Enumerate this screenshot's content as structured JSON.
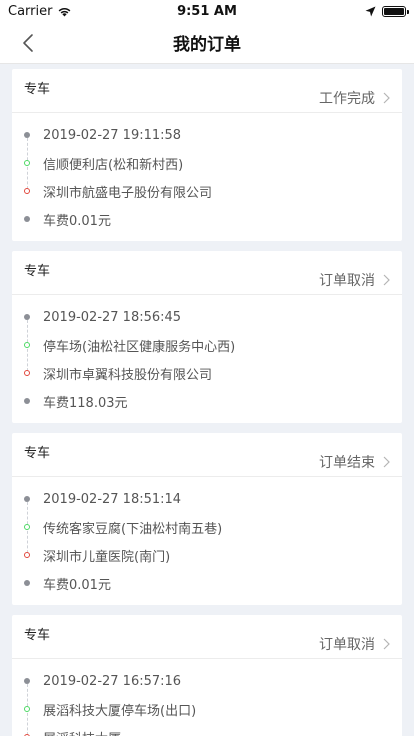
{
  "status_bar": {
    "carrier": "Carrier",
    "time": "9:51 AM"
  },
  "nav": {
    "title": "我的订单"
  },
  "orders": [
    {
      "type": "专车",
      "status": "工作完成",
      "datetime": "2019-02-27 19:11:58",
      "from": "信顺便利店(松和新村西)",
      "to": "深圳市航盛电子股份有限公司",
      "fare": "车费0.01元"
    },
    {
      "type": "专车",
      "status": "订单取消",
      "datetime": "2019-02-27 18:56:45",
      "from": "停车场(油松社区健康服务中心西)",
      "to": "深圳市卓翼科技股份有限公司",
      "fare": "车费118.03元"
    },
    {
      "type": "专车",
      "status": "订单结束",
      "datetime": "2019-02-27 18:51:14",
      "from": "传统客家豆腐(下油松村南五巷)",
      "to": "深圳市儿童医院(南门)",
      "fare": "车费0.01元"
    },
    {
      "type": "专车",
      "status": "订单取消",
      "datetime": "2019-02-27 16:57:16",
      "from": "展滔科技大厦停车场(出口)",
      "to": "展滔科技大厦",
      "fare": ""
    }
  ],
  "colors": {
    "background": "#eef1f6",
    "card": "#ffffff",
    "start_dot": "#4cd964",
    "end_dot": "#e2483d",
    "neutral_dot": "#8c8f96"
  },
  "icons": {
    "back": "chevron-left-icon",
    "status_arrow": "chevron-right-icon",
    "wifi": "wifi-icon",
    "location": "location-arrow-icon",
    "battery": "battery-icon"
  }
}
